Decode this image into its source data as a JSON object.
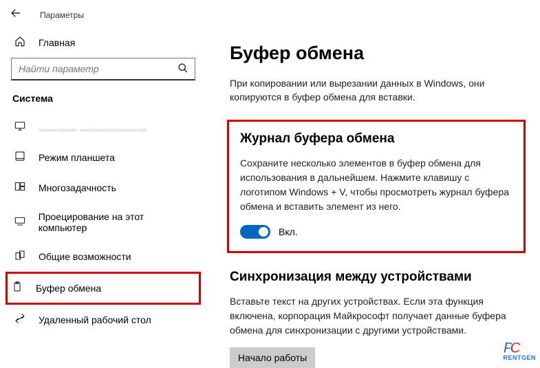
{
  "window": {
    "title": "Параметры"
  },
  "sidebar": {
    "home_label": "Главная",
    "search_placeholder": "Найти параметр",
    "group_label": "Система",
    "items": [
      {
        "icon": "display",
        "label": "………… …………………"
      },
      {
        "icon": "tablet",
        "label": "Режим планшета"
      },
      {
        "icon": "multitask",
        "label": "Многозадачность"
      },
      {
        "icon": "project",
        "label": "Проецирование на этот компьютер"
      },
      {
        "icon": "shared",
        "label": "Общие возможности"
      },
      {
        "icon": "clipboard",
        "label": "Буфер обмена"
      },
      {
        "icon": "remote",
        "label": "Удаленный рабочий стол"
      }
    ]
  },
  "main": {
    "title": "Буфер обмена",
    "description": "При копировании или вырезании данных в Windows, они копируются в буфер обмена для вставки.",
    "history": {
      "title": "Журнал буфера обмена",
      "description": "Сохраните несколько элементов в буфер обмена для использования в дальнейшем. Нажмите клавишу с логотипом Windows + V, чтобы просмотреть журнал буфера обмена и вставить элемент из него.",
      "toggle_label": "Вкл."
    },
    "sync": {
      "title": "Синхронизация между устройствами",
      "description": "Вставьте текст на других устройствах. Если эта функция включена, корпорация Майкрософт получает данные буфера обмена для синхронизации с другими устройствами.",
      "button_label": "Начало работы"
    }
  },
  "watermark": {
    "l1": "P",
    "l2": "C",
    "sub": "RENTGEN"
  }
}
